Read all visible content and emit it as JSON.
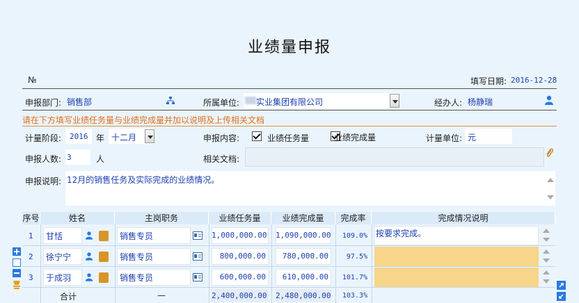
{
  "title": "业绩量申报",
  "number_label": "№",
  "fill_date": {
    "label": "填写日期:",
    "value": "2016-12-28"
  },
  "dept": {
    "label": "申报部门:",
    "value": "销售部"
  },
  "unit": {
    "label": "所属单位:",
    "value": "实业集团有限公司"
  },
  "handler": {
    "label": "经办人:",
    "value": "杨静瑞"
  },
  "notice": "请在下方填写业绩任务量与业绩完成量并加以说明及上传相关文档",
  "period": {
    "label": "计量阶段:",
    "year": "2016",
    "year_unit": "年",
    "month": "十二月"
  },
  "content": {
    "label": "申报内容:",
    "opt1": "业绩任务量",
    "opt2": "业绩完成量"
  },
  "measure_unit": {
    "label": "计量单位:",
    "value": "元"
  },
  "count": {
    "label": "申报人数:",
    "value": "3",
    "unit": "人"
  },
  "docs": {
    "label": "相关文档:"
  },
  "desc": {
    "label": "申报说明:",
    "value": "12月的销售任务及实际完成的业绩情况。"
  },
  "table": {
    "headers": [
      "序号",
      "姓名",
      "主岗职务",
      "业绩任务量",
      "业绩完成量",
      "完成率",
      "完成情况说明"
    ],
    "rows": [
      {
        "no": "1",
        "name": "甘恬",
        "role": "销售专员",
        "task": "1,000,000.00",
        "done": "1,090,000.00",
        "rate": "109.0%",
        "note": "按要求完成。"
      },
      {
        "no": "2",
        "name": "徐宁宁",
        "role": "销售专员",
        "task": "800,000.00",
        "done": "780,000.00",
        "rate": "97.5%",
        "note": ""
      },
      {
        "no": "3",
        "name": "于成羽",
        "role": "销售专员",
        "task": "600,000.00",
        "done": "610,000.00",
        "rate": "101.7%",
        "note": ""
      }
    ],
    "total": {
      "label": "合计",
      "role": "—",
      "task": "2,400,000.00",
      "done": "2,480,000.00",
      "rate": "103.3%"
    }
  },
  "colors": {
    "accent": "#1a3fb0",
    "notice": "#e0701a",
    "highlight": "#f7d58a",
    "header_bg": "#dbeaf8"
  }
}
